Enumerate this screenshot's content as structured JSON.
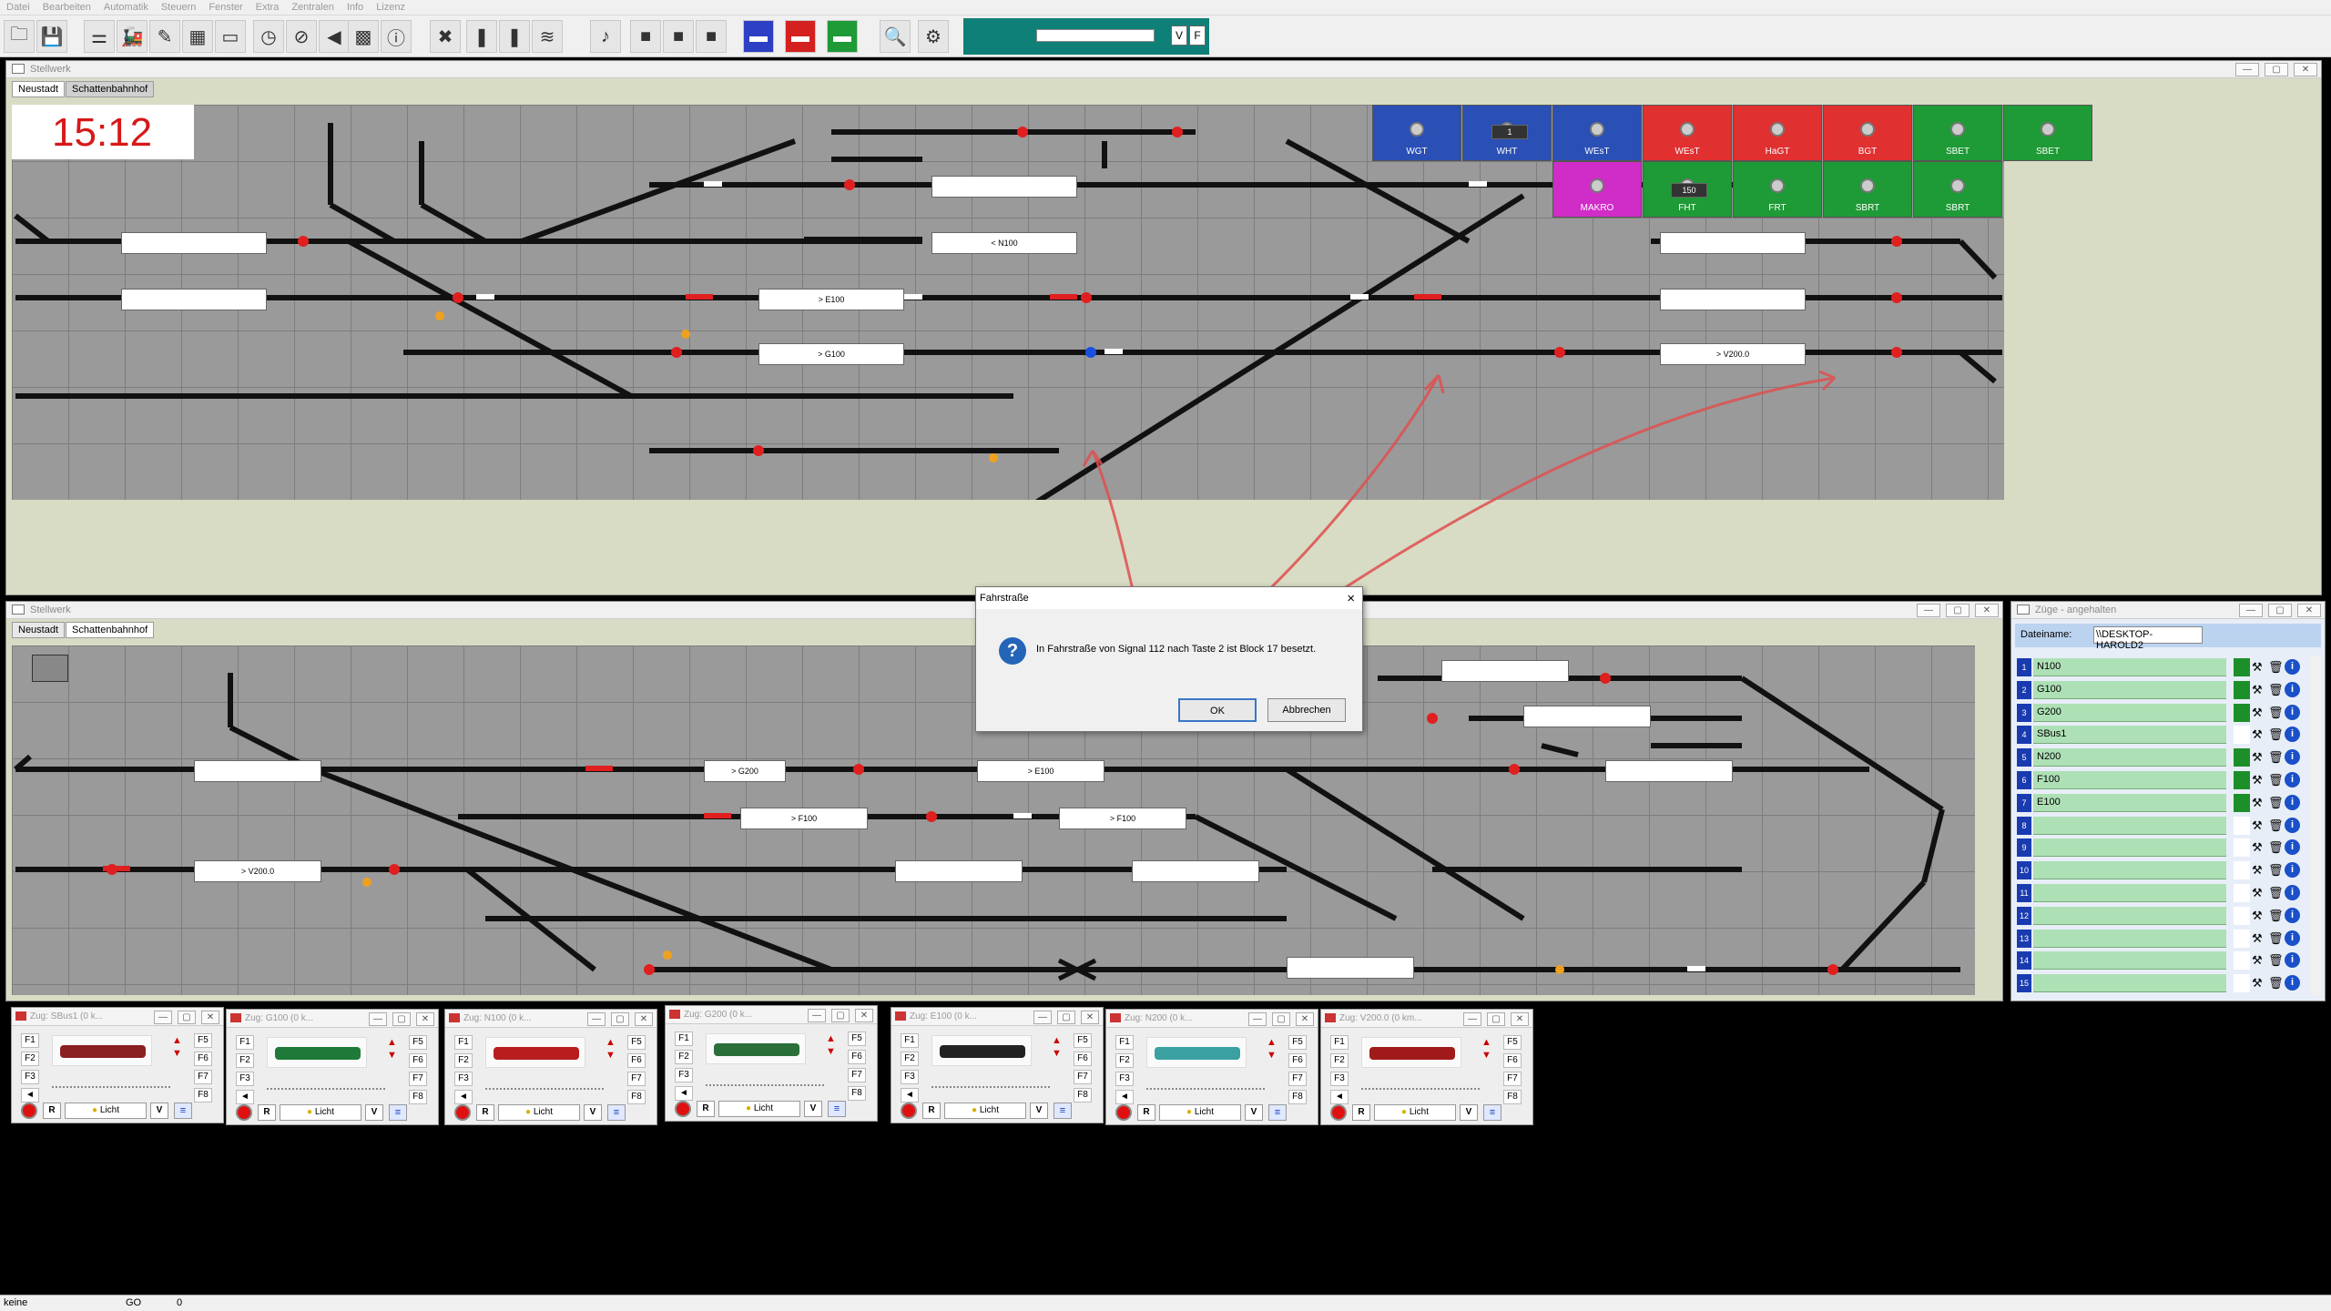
{
  "menu": [
    "Datei",
    "Bearbeiten",
    "Automatik",
    "Steuern",
    "Fenster",
    "Extra",
    "Zentralen",
    "Info",
    "Lizenz"
  ],
  "speed": {
    "v_label": "V",
    "f_label": "F"
  },
  "win1": {
    "title": "Stellwerk",
    "tabs": [
      "Neustadt",
      "Schattenbahnhof"
    ],
    "clock": "15:12",
    "labels": [
      "< N100",
      "> E100",
      "> G100",
      "> V200.0"
    ],
    "blocks": [
      {
        "label": "WGT",
        "color": "#2a4fb5"
      },
      {
        "label": "WHT",
        "color": "#2a4fb5"
      },
      {
        "label": "WEsT",
        "color": "#2a4fb5"
      },
      {
        "label": "WEsT",
        "color": "#e03030"
      },
      {
        "label": "HaGT",
        "color": "#e03030"
      },
      {
        "label": "BGT",
        "color": "#e03030"
      },
      {
        "label": "SBET",
        "color": "#1e9a36"
      },
      {
        "label": "SBET",
        "color": "#1e9a36"
      }
    ],
    "blocks2": [
      {
        "label": "MAKRO",
        "color": "#d02cc8"
      },
      {
        "label": "FHT",
        "color": "#1e9a36"
      },
      {
        "label": "FRT",
        "color": "#1e9a36"
      },
      {
        "label": "SBRT",
        "color": "#1e9a36"
      },
      {
        "label": "SBRT",
        "color": "#1e9a36"
      }
    ],
    "block_numbers": [
      "1",
      "150"
    ]
  },
  "win2": {
    "title": "Stellwerk",
    "tabs": [
      "Neustadt",
      "Schattenbahnhof"
    ],
    "labels": [
      "> G200",
      "> E100",
      "> F100",
      "> F100",
      "> V200.0"
    ]
  },
  "dialog": {
    "title": "Fahrstraße",
    "message": "In Fahrstraße von Signal 112 nach Taste 2 ist Block 17 besetzt.",
    "ok": "OK",
    "cancel": "Abbrechen",
    "close": "×"
  },
  "trains_panel": {
    "title": "Züge - angehalten",
    "file_label": "Dateiname:",
    "file_value": "\\\\DESKTOP-HAROLD2",
    "rows": [
      {
        "num": "1",
        "name": "N100",
        "active": true
      },
      {
        "num": "2",
        "name": "G100",
        "active": true
      },
      {
        "num": "3",
        "name": "G200",
        "active": true
      },
      {
        "num": "4",
        "name": "SBus1",
        "active": false
      },
      {
        "num": "5",
        "name": "N200",
        "active": true
      },
      {
        "num": "6",
        "name": "F100",
        "active": true
      },
      {
        "num": "7",
        "name": "E100",
        "active": true
      },
      {
        "num": "8",
        "name": "",
        "active": false
      },
      {
        "num": "9",
        "name": "",
        "active": false
      },
      {
        "num": "10",
        "name": "",
        "active": false
      },
      {
        "num": "11",
        "name": "",
        "active": false
      },
      {
        "num": "12",
        "name": "",
        "active": false
      },
      {
        "num": "13",
        "name": "",
        "active": false
      },
      {
        "num": "14",
        "name": "",
        "active": false
      },
      {
        "num": "15",
        "name": "",
        "active": false
      }
    ]
  },
  "cabs": [
    {
      "title": "Zug: SBus1 (0 k...",
      "color": "#8a2020"
    },
    {
      "title": "Zug: G100 (0 k...",
      "color": "#1f7a3a"
    },
    {
      "title": "Zug: N100 (0 k...",
      "color": "#b81e1e"
    },
    {
      "title": "Zug: G200 (0 k...",
      "color": "#2a6e3a"
    },
    {
      "title": "Zug: E100 (0 k...",
      "color": "#222222"
    },
    {
      "title": "Zug: N200 (0 k...",
      "color": "#3aa0a0"
    },
    {
      "title": "Zug: V200.0 (0 km...",
      "color": "#a01a1a"
    }
  ],
  "cab_keys": {
    "f1": "F1",
    "f2": "F2",
    "f3": "F3",
    "f5": "F5",
    "f6": "F6",
    "f7": "F7",
    "f8": "F8",
    "r": "R",
    "licht": "Licht",
    "v": "V"
  },
  "status": {
    "left": "keine",
    "mid": "GO",
    "num": "0"
  },
  "icons": {
    "info": "i",
    "tools": "⚒",
    "trash": "🗑"
  }
}
